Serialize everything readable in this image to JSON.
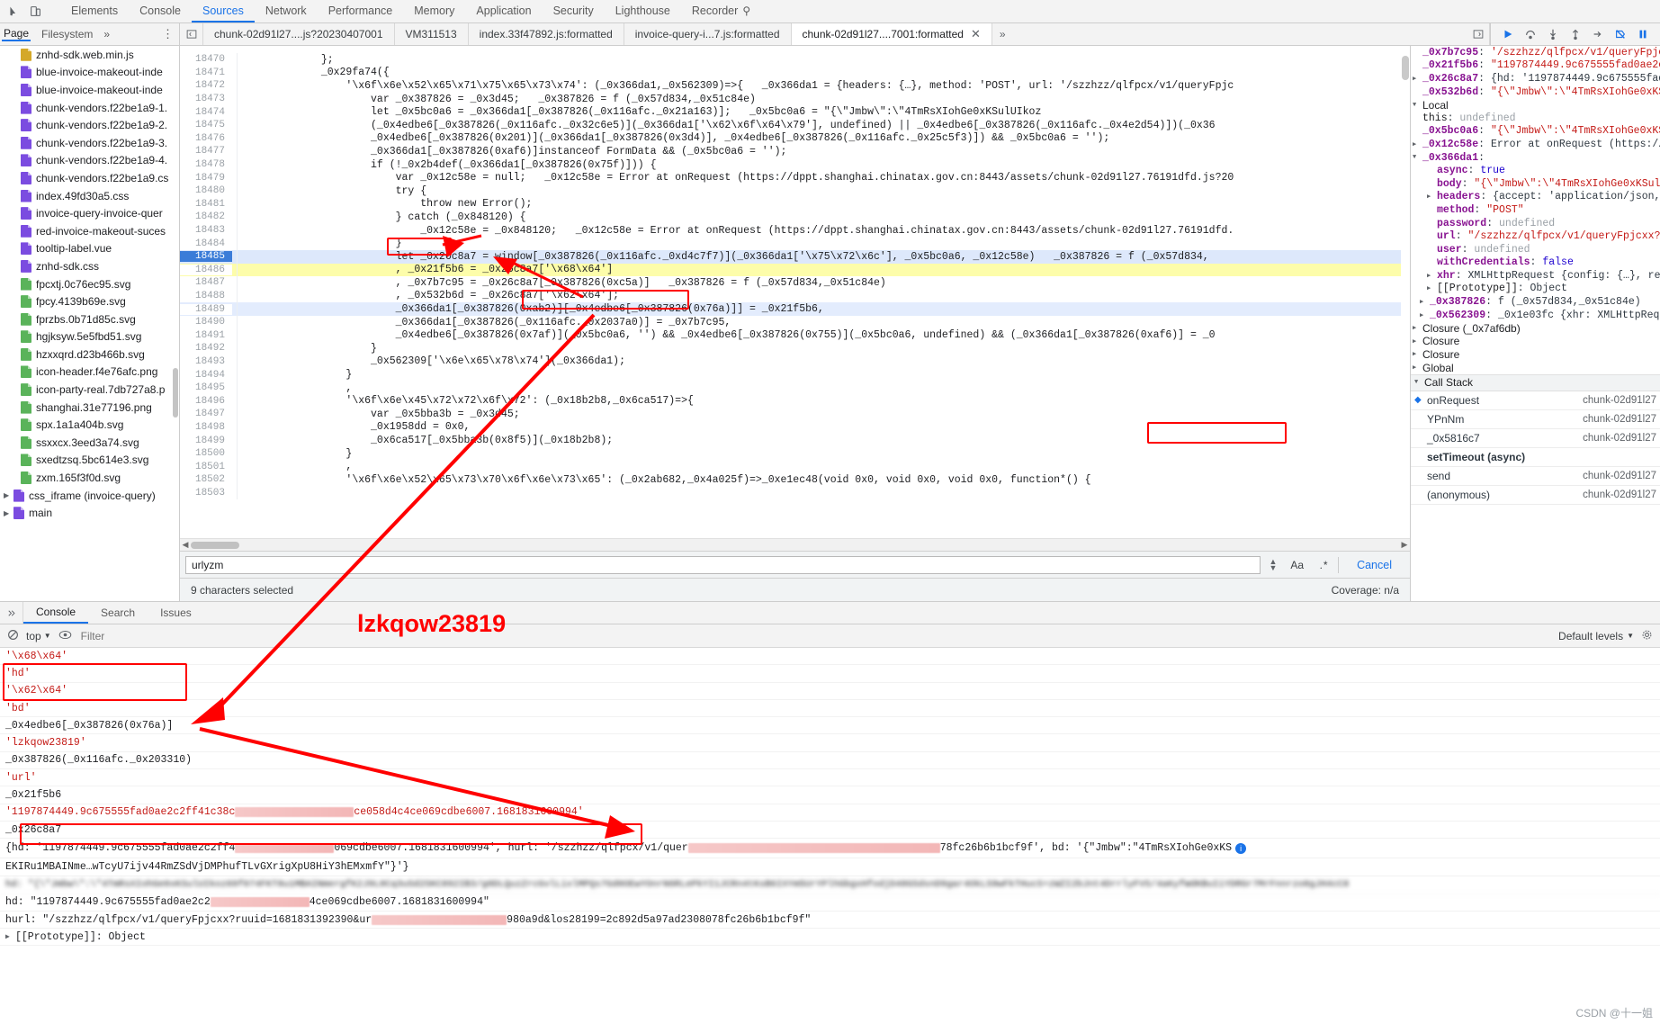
{
  "devtools": {
    "main_tabs": [
      {
        "label": "Elements",
        "active": false
      },
      {
        "label": "Console",
        "active": false
      },
      {
        "label": "Sources",
        "active": true
      },
      {
        "label": "Network",
        "active": false
      },
      {
        "label": "Performance",
        "active": false
      },
      {
        "label": "Memory",
        "active": false
      },
      {
        "label": "Application",
        "active": false
      },
      {
        "label": "Security",
        "active": false
      },
      {
        "label": "Lighthouse",
        "active": false
      },
      {
        "label": "Recorder",
        "active": false,
        "badge": "flask-icon"
      }
    ],
    "inspect_icon": "inspect-element-icon",
    "device_icon": "device-toolbar-icon"
  },
  "navigator": {
    "tabs": [
      {
        "label": "Page",
        "active": true
      },
      {
        "label": "Filesystem",
        "active": false
      },
      {
        "label": "»",
        "active": false
      }
    ],
    "more_icon": "kebab-menu-icon",
    "files": [
      {
        "name": "znhd-sdk.web.min.js",
        "color": "#d4a829",
        "indent": 1
      },
      {
        "name": "blue-invoice-makeout-inde",
        "color": "#7b4ce0",
        "indent": 1
      },
      {
        "name": "blue-invoice-makeout-inde",
        "color": "#7b4ce0",
        "indent": 1
      },
      {
        "name": "chunk-vendors.f22be1a9-1.",
        "color": "#7b4ce0",
        "indent": 1
      },
      {
        "name": "chunk-vendors.f22be1a9-2.",
        "color": "#7b4ce0",
        "indent": 1
      },
      {
        "name": "chunk-vendors.f22be1a9-3.",
        "color": "#7b4ce0",
        "indent": 1
      },
      {
        "name": "chunk-vendors.f22be1a9-4.",
        "color": "#7b4ce0",
        "indent": 1
      },
      {
        "name": "chunk-vendors.f22be1a9.cs",
        "color": "#7b4ce0",
        "indent": 1
      },
      {
        "name": "index.49fd30a5.css",
        "color": "#7b4ce0",
        "indent": 1
      },
      {
        "name": "invoice-query-invoice-quer",
        "color": "#7b4ce0",
        "indent": 1
      },
      {
        "name": "red-invoice-makeout-suces",
        "color": "#7b4ce0",
        "indent": 1
      },
      {
        "name": "tooltip-label.vue",
        "color": "#7b4ce0",
        "indent": 1
      },
      {
        "name": "znhd-sdk.css",
        "color": "#7b4ce0",
        "indent": 1
      },
      {
        "name": "fpcxtj.0c76ec95.svg",
        "color": "#5ab35a",
        "indent": 1
      },
      {
        "name": "fpcy.4139b69e.svg",
        "color": "#5ab35a",
        "indent": 1
      },
      {
        "name": "fprzbs.0b71d85c.svg",
        "color": "#5ab35a",
        "indent": 1
      },
      {
        "name": "hgjksyw.5e5fbd51.svg",
        "color": "#5ab35a",
        "indent": 1
      },
      {
        "name": "hzxxqrd.d23b466b.svg",
        "color": "#5ab35a",
        "indent": 1
      },
      {
        "name": "icon-header.f4e76afc.png",
        "color": "#5ab35a",
        "indent": 1
      },
      {
        "name": "icon-party-real.7db727a8.p",
        "color": "#5ab35a",
        "indent": 1
      },
      {
        "name": "shanghai.31e77196.png",
        "color": "#5ab35a",
        "indent": 1
      },
      {
        "name": "spx.1a1a404b.svg",
        "color": "#5ab35a",
        "indent": 1
      },
      {
        "name": "ssxxcx.3eed3a74.svg",
        "color": "#5ab35a",
        "indent": 1
      },
      {
        "name": "sxedtzsq.5bc614e3.svg",
        "color": "#5ab35a",
        "indent": 1
      },
      {
        "name": "zxm.165f3f0d.svg",
        "color": "#5ab35a",
        "indent": 1
      },
      {
        "name": "css_iframe (invoice-query)",
        "color": "#7b4ce0",
        "indent": 0,
        "folder": true
      },
      {
        "name": "main",
        "color": "#7b4ce0",
        "indent": 0,
        "folder": true
      }
    ]
  },
  "source_tabs": [
    {
      "label": "chunk-02d91l27....js?20230407001",
      "active": false,
      "closable": false
    },
    {
      "label": "VM311513",
      "active": false,
      "closable": false
    },
    {
      "label": "index.33f47892.js:formatted",
      "active": false,
      "closable": false
    },
    {
      "label": "invoice-query-i...7.js:formatted",
      "active": false,
      "closable": false
    },
    {
      "label": "chunk-02d91l27....7001:formatted",
      "active": true,
      "closable": true
    }
  ],
  "source_tabs_overflow": "»",
  "debugger_buttons": [
    {
      "name": "resume-script-execution"
    },
    {
      "name": "step-over-next-function-call"
    },
    {
      "name": "step-into-next-function-call"
    },
    {
      "name": "step-out-of-current-function"
    },
    {
      "name": "step"
    },
    {
      "name": "deactivate-breakpoints"
    },
    {
      "name": "pause-on-exceptions"
    }
  ],
  "editor": {
    "first_line": 18470,
    "execution_line": 18485,
    "highlight_line": 18486,
    "selected_line": 18489,
    "lines": [
      {
        "n": 18470,
        "text": "            };"
      },
      {
        "n": 18471,
        "text": "            _0x29fa74({"
      },
      {
        "n": 18472,
        "text": "                '\\x6f\\x6e\\x52\\x65\\x71\\x75\\x65\\x73\\x74': (_0x366da1,_0x562309)=>{   _0x366da1 = {headers: {…}, method: 'POST', url: '/szzhzz/qlfpcx/v1/queryFpjc"
      },
      {
        "n": 18473,
        "text": "                    var _0x387826 = _0x3d45;   _0x387826 = f (_0x57d834,_0x51c84e)"
      },
      {
        "n": 18474,
        "text": "                    let _0x5bc0a6 = _0x366da1[_0x387826(_0x116afc._0x21a163)];   _0x5bc0a6 = \"{\\\"Jmbw\\\":\\\"4TmRsXIohGe0xKSulUIkoz"
      },
      {
        "n": 18475,
        "text": "                    (_0x4edbe6[_0x387826(_0x116afc._0x32c6e5)](_0x366da1['\\x62\\x6f\\x64\\x79'], undefined) || _0x4edbe6[_0x387826(_0x116afc._0x4e2d54)])(_0x36"
      },
      {
        "n": 18476,
        "text": "                    _0x4edbe6[_0x387826(0x201)](_0x366da1[_0x387826(0x3d4)], _0x4edbe6[_0x387826(_0x116afc._0x25c5f3)]) && _0x5bc0a6 = '');"
      },
      {
        "n": 18477,
        "text": "                    _0x366da1[_0x387826(0xaf6)]instanceof FormData && (_0x5bc0a6 = '');"
      },
      {
        "n": 18478,
        "text": "                    if (!_0x2b4def(_0x366da1[_0x387826(0x75f)])) {"
      },
      {
        "n": 18479,
        "text": "                        var _0x12c58e = null;   _0x12c58e = Error at onRequest (https://dppt.shanghai.chinatax.gov.cn:8443/assets/chunk-02d91l27.76191dfd.js?20"
      },
      {
        "n": 18480,
        "text": "                        try {"
      },
      {
        "n": 18481,
        "text": "                            throw new Error();"
      },
      {
        "n": 18482,
        "text": "                        } catch (_0x848120) {"
      },
      {
        "n": 18483,
        "text": "                            _0x12c58e = _0x848120;   _0x12c58e = Error at onRequest (https://dppt.shanghai.chinatax.gov.cn:8443/assets/chunk-02d91l27.76191dfd."
      },
      {
        "n": 18484,
        "text": "                        }"
      },
      {
        "n": 18485,
        "text": "                        let _0x26c8a7 = window[_0x387826(_0x116afc._0xd4c7f7)](_0x366da1['\\x75\\x72\\x6c'], _0x5bc0a6, _0x12c58e)   _0x387826 = f (_0x57d834,"
      },
      {
        "n": 18486,
        "text": "                        , _0x21f5b6 = _0x26c8a7['\\x68\\x64']"
      },
      {
        "n": 18487,
        "text": "                        , _0x7b7c95 = _0x26c8a7[_0x387826(0xc5a)]   _0x387826 = f (_0x57d834,_0x51c84e)"
      },
      {
        "n": 18488,
        "text": "                        , _0x532b6d = _0x26c8a7['\\x62\\x64'];"
      },
      {
        "n": 18489,
        "text": "                        _0x366da1[_0x387826(0xab2)][_0x4edbe6[_0x387826(0x76a)]] = _0x21f5b6,"
      },
      {
        "n": 18490,
        "text": "                        _0x366da1[_0x387826(_0x116afc._0x2037a0)] = _0x7b7c95,"
      },
      {
        "n": 18491,
        "text": "                        _0x4edbe6[_0x387826(0x7af)](_0x5bc0a6, '') && _0x4edbe6[_0x387826(0x755)](_0x5bc0a6, undefined) && (_0x366da1[_0x387826(0xaf6)] = _0"
      },
      {
        "n": 18492,
        "text": "                    }"
      },
      {
        "n": 18493,
        "text": "                    _0x562309['\\x6e\\x65\\x78\\x74'](_0x366da1);"
      },
      {
        "n": 18494,
        "text": "                }"
      },
      {
        "n": 18495,
        "text": "                ,"
      },
      {
        "n": 18496,
        "text": "                '\\x6f\\x6e\\x45\\x72\\x72\\x6f\\x72': (_0x18b2b8,_0x6ca517)=>{"
      },
      {
        "n": 18497,
        "text": "                    var _0x5bba3b = _0x3d45;"
      },
      {
        "n": 18498,
        "text": "                    _0x1958dd = 0x0,"
      },
      {
        "n": 18499,
        "text": "                    _0x6ca517[_0x5bba3b(0x8f5)](_0x18b2b8);"
      },
      {
        "n": 18500,
        "text": "                }"
      },
      {
        "n": 18501,
        "text": "                ,"
      },
      {
        "n": 18502,
        "text": "                '\\x6f\\x6e\\x52\\x65\\x73\\x70\\x6f\\x6e\\x73\\x65': (_0x2ab682,_0x4a025f)=>_0xe1ec48(void 0x0, void 0x0, void 0x0, function*() {"
      },
      {
        "n": 18503,
        "text": ""
      }
    ]
  },
  "findbar": {
    "value": "urlyzm",
    "placeholder": "Find",
    "match_case_label": "Aa",
    "regex_label": ".*",
    "cancel_label": "Cancel",
    "up_icon": "chevron-up-icon",
    "down_icon": "chevron-down-icon"
  },
  "statusbar": {
    "left": "9 characters selected",
    "right": "Coverage: n/a"
  },
  "debug_pane": {
    "top_rows": [
      {
        "tri": "",
        "key": "_0x7b7c95",
        "sep": ": ",
        "val": "'/szzhzz/qlfpcx/v1/queryFpjcx",
        "cls": "dp-val-str",
        "bold": true
      },
      {
        "tri": "",
        "key": "_0x21f5b6",
        "sep": ": ",
        "val": "\"1197874449.9c675555fad0ae2c2f",
        "cls": "dp-val-str",
        "bold": true
      },
      {
        "tri": "▶",
        "key": "_0x26c8a7",
        "sep": ": ",
        "val": "{hd: '1197874449.9c675555fad0",
        "cls": "dp-obj",
        "bold": true
      },
      {
        "tri": "",
        "key": "_0x532b6d",
        "sep": ": ",
        "val": "\"{\\\"Jmbw\\\":\\\"4TmRsXIohGe0xKSu",
        "cls": "dp-val-str",
        "bold": true
      }
    ],
    "local_label": "Local",
    "local_rows": [
      {
        "tri": "",
        "key": "this",
        "sep": ": ",
        "val": "undefined",
        "cls": "dp-undef",
        "bold": false
      },
      {
        "tri": "",
        "key": "_0x5bc0a6",
        "sep": ": ",
        "val": "\"{\\\"Jmbw\\\":\\\"4TmRsXIohGe0xKSulUI",
        "cls": "dp-val-str",
        "bold": true
      },
      {
        "tri": "▶",
        "key": "_0x12c58e",
        "sep": ": ",
        "val": "Error at onRequest (https://dp",
        "cls": "dp-obj",
        "bold": true
      },
      {
        "tri": "▼",
        "key": "_0x366da1",
        "sep": ":",
        "val": "",
        "cls": "dp-obj",
        "bold": true
      },
      {
        "tri": "",
        "key": "async",
        "sep": ": ",
        "val": "true",
        "cls": "dp-val-kw",
        "bold": true,
        "indent": 2
      },
      {
        "tri": "",
        "key": "body",
        "sep": ": ",
        "val": "\"{\\\"Jmbw\\\":\\\"4TmRsXIohGe0xKSulUIk",
        "cls": "dp-val-str",
        "bold": true,
        "indent": 2
      },
      {
        "tri": "▶",
        "key": "headers",
        "sep": ": ",
        "val": "{accept: 'application/json, te",
        "cls": "dp-obj",
        "bold": true,
        "indent": 2
      },
      {
        "tri": "",
        "key": "method",
        "sep": ": ",
        "val": "\"POST\"",
        "cls": "dp-val-str",
        "bold": true,
        "indent": 2
      },
      {
        "tri": "",
        "key": "password",
        "sep": ": ",
        "val": "undefined",
        "cls": "dp-undef",
        "bold": true,
        "indent": 2
      },
      {
        "tri": "",
        "key": "url",
        "sep": ": ",
        "val": "\"/szzhzz/qlfpcx/v1/queryFpjcxx?ruu",
        "cls": "dp-val-str",
        "bold": true,
        "indent": 2
      },
      {
        "tri": "",
        "key": "user",
        "sep": ": ",
        "val": "undefined",
        "cls": "dp-undef",
        "bold": true,
        "indent": 2
      },
      {
        "tri": "",
        "key": "withCredentials",
        "sep": ": ",
        "val": "false",
        "cls": "dp-val-kw",
        "bold": true,
        "indent": 2
      },
      {
        "tri": "▶",
        "key": "xhr",
        "sep": ": ",
        "val": "XMLHttpRequest {config: {…}, ready",
        "cls": "dp-obj",
        "bold": true,
        "indent": 2
      },
      {
        "tri": "▶",
        "key": "[[Prototype]]",
        "sep": ": ",
        "val": "Object",
        "cls": "dp-obj",
        "bold": false,
        "indent": 2
      },
      {
        "tri": "▶",
        "key": "_0x387826",
        "sep": ": ",
        "val": "f (_0x57d834,_0x51c84e)",
        "cls": "dp-obj",
        "bold": true,
        "indent": 1
      },
      {
        "tri": "▶",
        "key": "_0x562309",
        "sep": ": ",
        "val": "_0x1e03fc {xhr: XMLHttpRequest",
        "cls": "dp-obj",
        "bold": true,
        "indent": 1
      }
    ],
    "closures": [
      {
        "tri": "▶",
        "label": "Closure (_0x7af6db)"
      },
      {
        "tri": "▶",
        "label": "Closure"
      },
      {
        "tri": "▶",
        "label": "Closure"
      },
      {
        "tri": "▶",
        "label": "Global"
      }
    ],
    "call_stack_label": "Call Stack",
    "call_stack": [
      {
        "name": "onRequest",
        "location": "chunk-02d91l27",
        "current": true,
        "highlighted": true
      },
      {
        "name": "YPnNm",
        "location": "chunk-02d91l27",
        "current": false,
        "highlighted": false
      },
      {
        "name": "_0x5816c7",
        "location": "chunk-02d91l27",
        "current": false,
        "highlighted": false
      },
      {
        "name": "setTimeout (async)",
        "location": "",
        "current": false,
        "highlighted": false,
        "bold": true
      },
      {
        "name": "send",
        "location": "chunk-02d91l27",
        "current": false,
        "highlighted": false
      },
      {
        "name": "(anonymous)",
        "location": "chunk-02d91l27",
        "current": false,
        "highlighted": false
      }
    ]
  },
  "drawer": {
    "tabs": [
      {
        "label": "Console",
        "active": true
      },
      {
        "label": "Search",
        "active": false
      },
      {
        "label": "Issues",
        "active": false
      }
    ],
    "close_icon": "close-icon",
    "toolbar": {
      "clear_icon": "clear-console-icon",
      "context": "top",
      "eye_icon": "live-expression-icon",
      "filter_placeholder": "Filter",
      "levels": "Default levels",
      "settings_icon": "settings-gear-icon",
      "menu_icon": "kebab-menu-icon"
    },
    "lines": [
      {
        "text": "'\\x68\\x64'",
        "kind": "str"
      },
      {
        "text": "'hd'",
        "kind": "str"
      },
      {
        "text": "'\\x62\\x64'",
        "kind": "str"
      },
      {
        "text": "'bd'",
        "kind": "str"
      },
      {
        "text": "_0x4edbe6[_0x387826(0x76a)]",
        "kind": "plain"
      },
      {
        "text": "'lzkqow23819'",
        "kind": "str"
      },
      {
        "text": "_0x387826(_0x116afc._0x203310)",
        "kind": "plain"
      },
      {
        "text": "'url'",
        "kind": "str"
      },
      {
        "text": "_0x21f5b6",
        "kind": "plain"
      },
      {
        "text": "'1197874449.9c675555fad0ae2c2ff41c38c",
        "kind": "str",
        "redacted_tail": "ce058d4c4ce069cdbe6007.1681831600994'"
      },
      {
        "text": "_0x26c8a7",
        "kind": "plain"
      },
      {
        "text": "{hd: '1197874449.9c675555fad0ae2c2ff4",
        "kind": "obj",
        "tail": "069cdbe6007.1681831600994', hurl: '/szzhzz/qlfpcx/v1/quer",
        "tail2": "78fc26b6b1bcf9f', bd: '{\"Jmbw\":\"4TmRsXIohGe0xKS"
      },
      {
        "text": "EKIRu1MBAINme…wTcyU7ijv44RmZSdVjDMPhufTLvGXrigXpU8HiY3hEMxmfY\"}'}",
        "kind": "obj"
      },
      {
        "text": "hd: \"{\\\"Jmbw\\\":\\\"4TmRsXIohGe0xKSulUIkoz69f074FKT8u1MBAINmergfK2J9L0Cq3uSd2SKC892IB3/g0DLQuzZrcGvlLixlMPQs7Gd0OEwYOnrN6RLePkYI1JCRn4tKsB6IXYm5UrYPlhGbgxHfodjD48GSdsnD9gar4OkLS9wFkTHucS+zWZI2bJnt4DrrlyFVS/4aKyfWdKBuIiYDRGr7MrFnnrzo8gJH4cC8",
        "kind": "hd"
      },
      {
        "text": "hd: \"1197874449.9c675555fad0ae2c2",
        "kind": "hdbox",
        "tail": "4ce069cdbe6007.1681831600994\""
      },
      {
        "text": "hurl: \"/szzhzz/qlfpcx/v1/queryFpjcxx?ruuid=1681831392390&ur",
        "kind": "hurl",
        "tail": "980a9d&los28199=2c892d5a97ad2308078fc26b6b1bcf9f\""
      },
      {
        "text": "[[Prototype]]: Object",
        "kind": "proto"
      }
    ],
    "annotation_text": "lzkqow23819"
  },
  "watermark": "CSDN @十一姐",
  "colors": {
    "accent": "#1a73e8",
    "annotation": "#ff0000",
    "execution_highlight": "#dde8fb",
    "search_highlight": "#fdfdaa"
  }
}
